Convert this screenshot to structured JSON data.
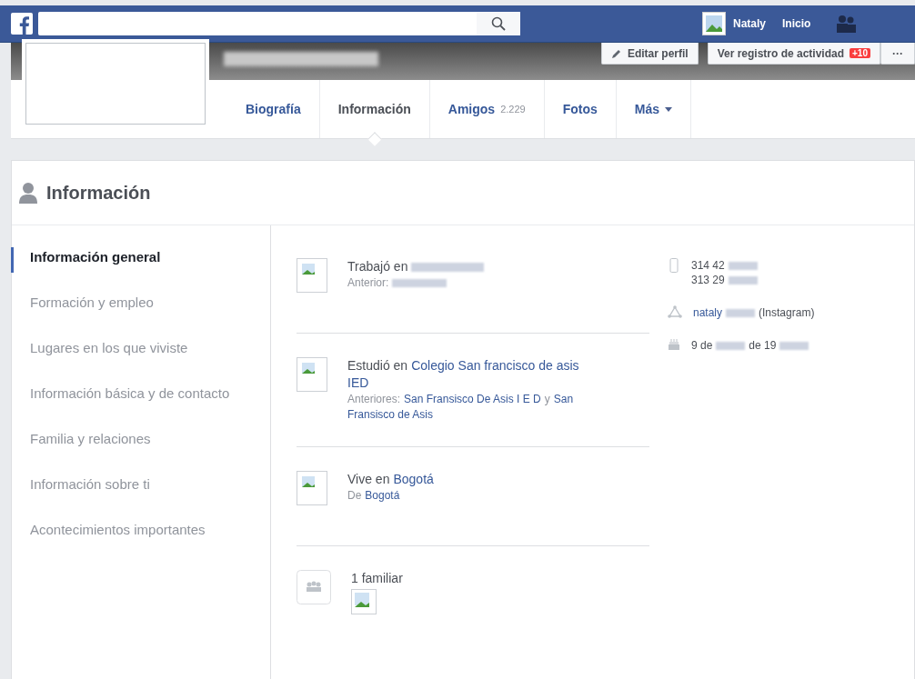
{
  "topbar": {
    "user": "Nataly",
    "home": "Inicio"
  },
  "cover": {
    "buttons": [
      {
        "kind": "edit",
        "label": "Editar perfil"
      },
      {
        "kind": "activity",
        "label": "Ver registro de actividad",
        "badge": "+10"
      },
      {
        "kind": "more",
        "label": "···"
      }
    ]
  },
  "tabs": [
    {
      "label": "Biografía",
      "selected": false
    },
    {
      "label": "Información",
      "selected": true
    },
    {
      "label": "Amigos",
      "count": "2.229",
      "selected": false
    },
    {
      "label": "Fotos",
      "selected": false
    },
    {
      "label": "Más",
      "dropdown": true,
      "selected": false
    }
  ],
  "section_title": "Información",
  "sidebar": [
    {
      "label": "Información general",
      "selected": true
    },
    {
      "label": "Formación y empleo",
      "selected": false
    },
    {
      "label": "Lugares en los que viviste",
      "selected": false
    },
    {
      "label": "Información básica y de contacto",
      "selected": false
    },
    {
      "label": "Familia y relaciones",
      "selected": false
    },
    {
      "label": "Información sobre ti",
      "selected": false
    },
    {
      "label": "Acontecimientos importantes",
      "selected": false
    }
  ],
  "entries": [
    {
      "kind": "image",
      "main": [
        [
          {
            "kind": "plain",
            "text": "Trabajó en"
          },
          {
            "kind": "blur"
          }
        ]
      ],
      "sub": [
        [
          {
            "kind": "plain",
            "text": "Anterior:"
          },
          {
            "kind": "blur"
          }
        ]
      ]
    },
    {
      "kind": "image",
      "main": [
        [
          {
            "kind": "plain",
            "text": "Estudió en"
          },
          {
            "kind": "link",
            "text": "Colegio San francisco de asis"
          }
        ],
        [
          {
            "kind": "link",
            "text": "IED"
          }
        ]
      ],
      "sub": [
        [
          {
            "kind": "plain",
            "text": "Anteriores:"
          },
          {
            "kind": "link",
            "text": "San Fransisco De Asis I E D"
          },
          {
            "kind": "plain",
            "text": "y"
          },
          {
            "kind": "link",
            "text": "San"
          }
        ],
        [
          {
            "kind": "link",
            "text": "Fransisco de Asis"
          }
        ]
      ]
    },
    {
      "kind": "image",
      "main": [
        [
          {
            "kind": "plain",
            "text": "Vive en"
          },
          {
            "kind": "link",
            "text": "Bogotá"
          }
        ]
      ],
      "sub": [
        [
          {
            "kind": "plain",
            "text": "De"
          },
          {
            "kind": "link",
            "text": "Bogotá"
          }
        ]
      ]
    },
    {
      "kind": "family",
      "main": [
        [
          {
            "kind": "plain",
            "text": "1 familiar"
          }
        ]
      ],
      "thumb": true
    }
  ],
  "contact": [
    {
      "kind": "phone",
      "lines": [
        [
          {
            "kind": "plain",
            "text": "314 42"
          },
          {
            "kind": "blur"
          }
        ],
        [
          {
            "kind": "plain",
            "text": "313 29"
          },
          {
            "kind": "blur"
          }
        ]
      ]
    },
    {
      "kind": "network",
      "lines": [
        [
          {
            "kind": "link",
            "text": "nataly"
          },
          {
            "kind": "blur"
          },
          {
            "kind": "plain",
            "text": "(Instagram)"
          }
        ]
      ]
    },
    {
      "kind": "birthday",
      "lines": [
        [
          {
            "kind": "plain",
            "text": "9 de"
          },
          {
            "kind": "blur"
          },
          {
            "kind": "plain",
            "text": "de 19"
          },
          {
            "kind": "blur"
          }
        ]
      ]
    }
  ]
}
